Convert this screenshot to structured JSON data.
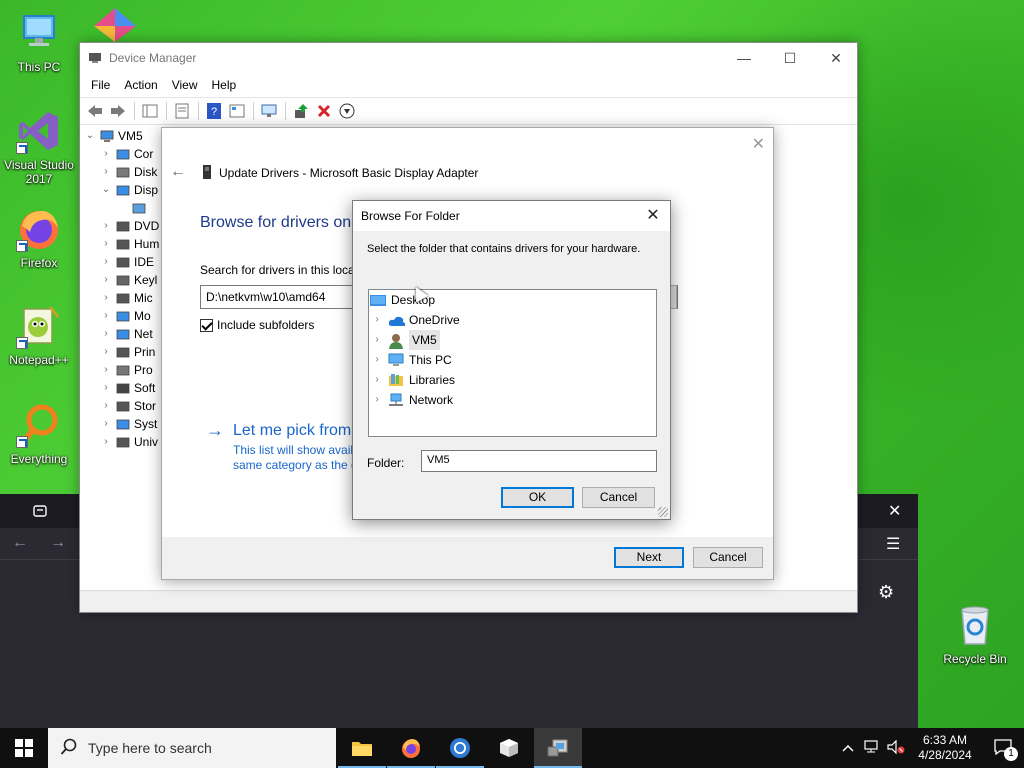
{
  "desktop": {
    "icons": [
      {
        "label": "This PC",
        "icon": "this-pc-icon"
      },
      {
        "label": "Visual Studio\n2017",
        "icon": "visual-studio-icon"
      },
      {
        "label": "Firefox",
        "icon": "firefox-icon"
      },
      {
        "label": "Notepad++",
        "icon": "notepadpp-icon"
      },
      {
        "label": "Everything",
        "icon": "everything-icon"
      },
      {
        "label": "Recycle Bin",
        "icon": "recycle-bin-icon"
      }
    ]
  },
  "device_manager": {
    "title": "Device Manager",
    "menu": [
      "File",
      "Action",
      "View",
      "Help"
    ],
    "tree": {
      "root": "VM5",
      "items": [
        "Cor",
        "Disk",
        "Disp",
        "",
        "DVD",
        "Hum",
        "IDE",
        "Keyl",
        "Mic",
        "Mo",
        "Net",
        "Prin",
        "Pro",
        "Soft",
        "Stor",
        "Syst",
        "Univ"
      ]
    }
  },
  "wizard": {
    "title": "Update Drivers - Microsoft Basic Display Adapter",
    "heading": "Browse for drivers on",
    "search_label": "Search for drivers in this locat",
    "path_value": "D:\\netkvm\\w10\\amd64",
    "include_subfolders": "Include subfolders",
    "pick_link": "Let me pick from",
    "pick_desc_1": "This list will show avail",
    "pick_desc_2": "same category as the d",
    "next": "Next",
    "cancel": "Cancel"
  },
  "browse_dialog": {
    "title": "Browse For Folder",
    "instruction": "Select the folder that contains drivers for your hardware.",
    "tree": [
      {
        "label": "Desktop",
        "icon": "desktop-folder-icon",
        "expandable": false
      },
      {
        "label": "OneDrive",
        "icon": "onedrive-icon",
        "expandable": true
      },
      {
        "label": "VM5",
        "icon": "user-folder-icon",
        "expandable": true,
        "selected": true
      },
      {
        "label": "This PC",
        "icon": "this-pc-icon",
        "expandable": true
      },
      {
        "label": "Libraries",
        "icon": "libraries-icon",
        "expandable": true
      },
      {
        "label": "Network",
        "icon": "network-icon",
        "expandable": true
      }
    ],
    "folder_label": "Folder:",
    "folder_value": "VM5",
    "ok": "OK",
    "cancel": "Cancel"
  },
  "taskbar": {
    "search_placeholder": "Type here to search",
    "time": "6:33 AM",
    "date": "4/28/2024",
    "notification_count": "1"
  }
}
